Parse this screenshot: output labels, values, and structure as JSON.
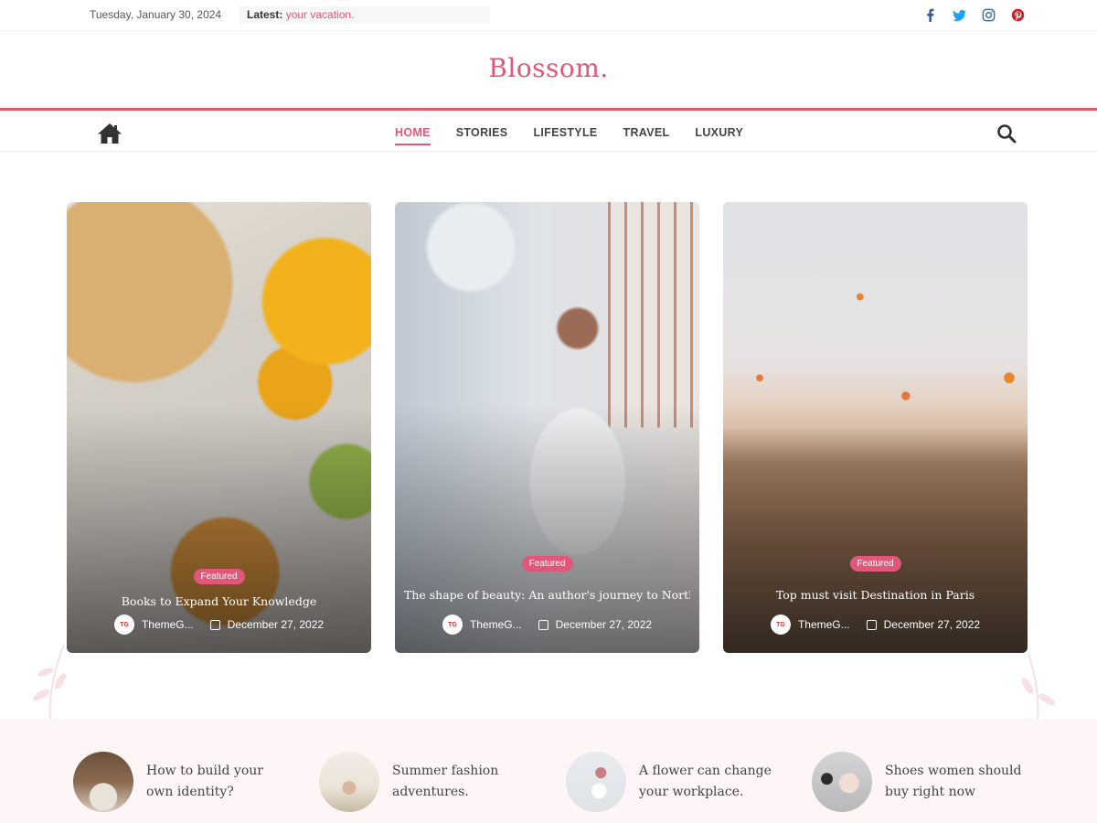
{
  "topbar": {
    "date": "Tuesday, January 30, 2024",
    "latest_label": "Latest:",
    "latest_value": "your vacation.",
    "social": [
      "facebook-icon",
      "twitter-icon",
      "instagram-icon",
      "pinterest-icon"
    ]
  },
  "brand": "Blossom.",
  "nav": {
    "items": [
      "HOME",
      "STORIES",
      "LIFESTYLE",
      "TRAVEL",
      "LUXURY"
    ],
    "active": "HOME"
  },
  "cards": [
    {
      "badge": "Featured",
      "title": "Books to Expand Your Knowledge",
      "author": "ThemeG...",
      "date": "December 27, 2022",
      "image": "sunflowers-book-hat-photo"
    },
    {
      "badge": "Featured",
      "title": "The shape of beauty: An author's journey to North",
      "author": "ThemeG...",
      "date": "December 27, 2022",
      "image": "woman-white-dress-window-photo"
    },
    {
      "badge": "Featured",
      "title": "Top must visit Destination in Paris",
      "author": "ThemeG...",
      "date": "December 27, 2022",
      "image": "cappadocia-balloons-photo"
    }
  ],
  "posts": [
    {
      "title_line1": "How to build your",
      "title_line2": "own identity?",
      "image": "living-room-photo"
    },
    {
      "title_line1": "Summer fashion",
      "title_line2": "adventures.",
      "image": "fashion-room-photo"
    },
    {
      "title_line1": "A flower can change",
      "title_line2": "your workplace.",
      "image": "vase-flowers-photo"
    },
    {
      "title_line1": "Shoes women should",
      "title_line2": "buy right now",
      "image": "shoes-flowers-photo"
    }
  ],
  "colors": {
    "accent": "#e0577a",
    "nav_border": "#e05a6d",
    "strip_bg": "#fdf5f6",
    "facebook": "#3b5998",
    "twitter": "#1da1f2",
    "instagram": "#3f729b",
    "pinterest": "#cb2027"
  }
}
